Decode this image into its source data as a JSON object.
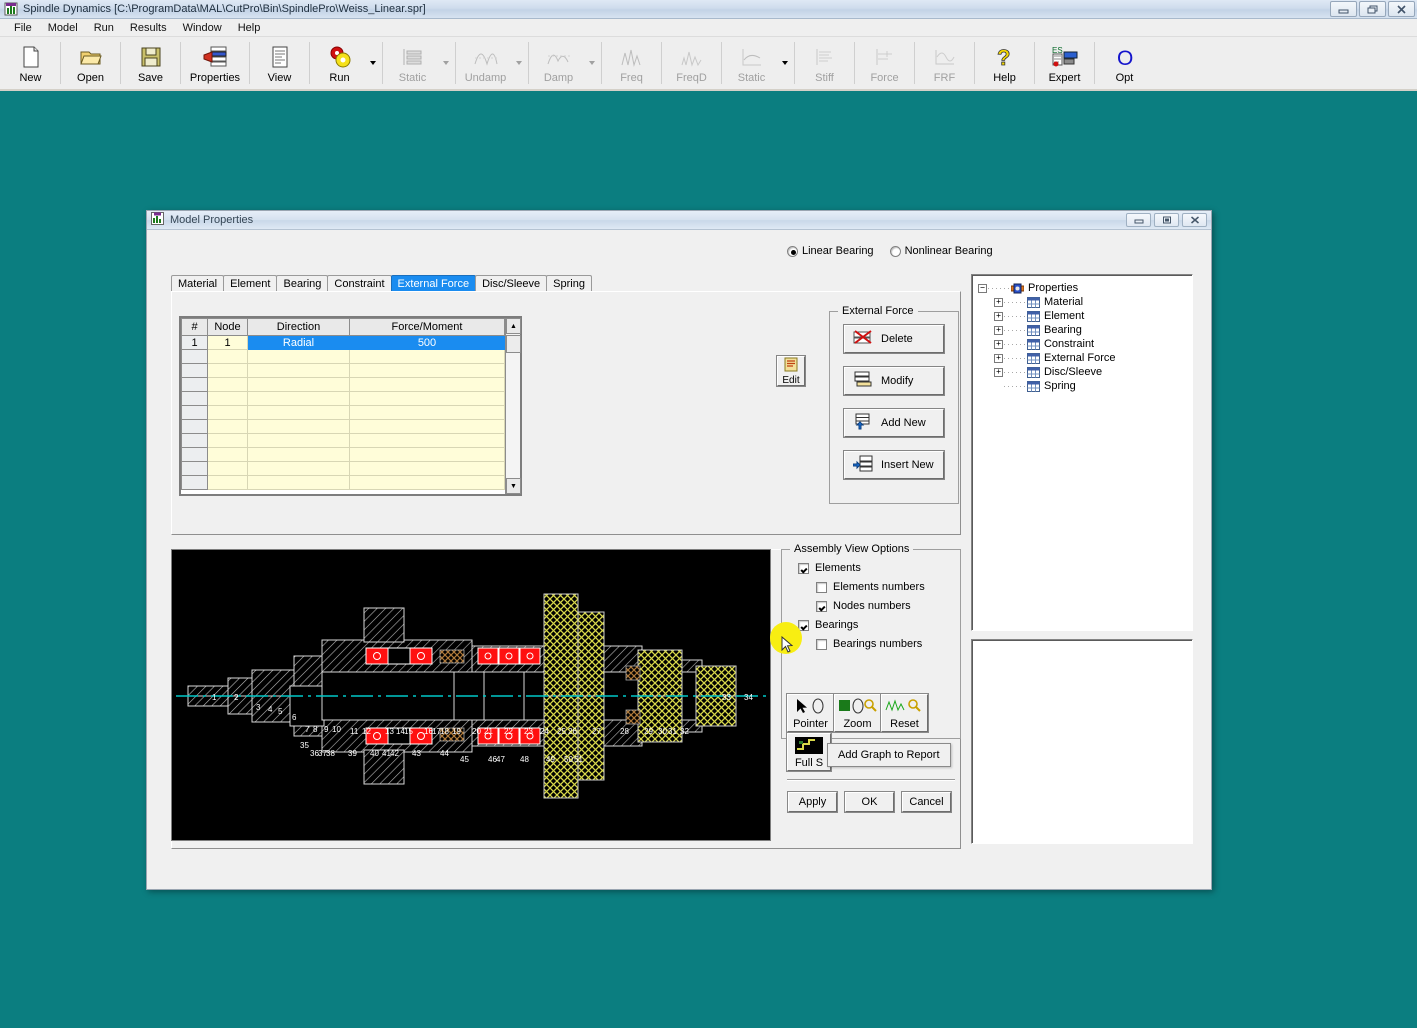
{
  "app": {
    "title": "Spindle Dynamics [C:\\ProgramData\\MAL\\CutPro\\Bin\\SpindlePro\\Weiss_Linear.spr]",
    "icon": "spindle-app-icon",
    "window_buttons": [
      {
        "name": "minimize",
        "glyph": "—"
      },
      {
        "name": "restore",
        "glyph": "❐"
      },
      {
        "name": "close",
        "glyph": "✕"
      }
    ],
    "menu": [
      {
        "label": "File"
      },
      {
        "label": "Model"
      },
      {
        "label": "Run"
      },
      {
        "label": "Results"
      },
      {
        "label": "Window"
      },
      {
        "label": "Help"
      }
    ]
  },
  "toolbar": {
    "buttons": [
      {
        "label": "New",
        "icon": "new-document-icon",
        "enabled": true,
        "dropdown": false
      },
      {
        "label": "Open",
        "icon": "open-folder-icon",
        "enabled": true,
        "dropdown": false
      },
      {
        "label": "Save",
        "icon": "floppy-disk-icon",
        "enabled": true,
        "dropdown": false
      },
      {
        "label": "Properties",
        "icon": "properties-icon",
        "enabled": true,
        "dropdown": false
      },
      {
        "label": "View",
        "icon": "view-page-icon",
        "enabled": true,
        "dropdown": false
      },
      {
        "label": "Run",
        "icon": "run-gears-icon",
        "enabled": true,
        "dropdown": true
      },
      {
        "label": "Static",
        "icon": "static-icon",
        "enabled": false,
        "dropdown": true
      },
      {
        "label": "Undamp",
        "icon": "undamped-icon",
        "enabled": false,
        "dropdown": true
      },
      {
        "label": "Damp",
        "icon": "damped-icon",
        "enabled": false,
        "dropdown": true
      },
      {
        "label": "Freq",
        "icon": "frequency-icon",
        "enabled": false,
        "dropdown": false
      },
      {
        "label": "FreqD",
        "icon": "frequency-d-icon",
        "enabled": false,
        "dropdown": false
      },
      {
        "label": "Static",
        "icon": "static-plot-icon",
        "enabled": false,
        "dropdown": true
      },
      {
        "label": "Stiff",
        "icon": "stiffness-icon",
        "enabled": false,
        "dropdown": false
      },
      {
        "label": "Force",
        "icon": "force-icon",
        "enabled": false,
        "dropdown": false
      },
      {
        "label": "FRF",
        "icon": "frf-icon",
        "enabled": false,
        "dropdown": false
      },
      {
        "label": "Help",
        "icon": "help-question-icon",
        "enabled": true,
        "dropdown": false
      },
      {
        "label": "Expert",
        "icon": "expert-system-icon",
        "enabled": true,
        "dropdown": false
      },
      {
        "label": "Opt",
        "icon": "optimization-icon",
        "enabled": true,
        "dropdown": false
      }
    ]
  },
  "dialog": {
    "title": "Model Properties",
    "icon": "model-properties-icon",
    "window_buttons": [
      {
        "name": "minimize",
        "glyph": "—"
      },
      {
        "name": "maximize",
        "glyph": "▣"
      },
      {
        "name": "close",
        "glyph": "✕"
      }
    ],
    "bearing_mode": {
      "options": [
        {
          "label": "Linear Bearing",
          "selected": true
        },
        {
          "label": "Nonlinear Bearing",
          "selected": false
        }
      ]
    },
    "tabs": [
      {
        "label": "Material",
        "active": false
      },
      {
        "label": "Element",
        "active": false
      },
      {
        "label": "Bearing",
        "active": false
      },
      {
        "label": "Constraint",
        "active": false
      },
      {
        "label": "External Force",
        "active": true
      },
      {
        "label": "Disc/Sleeve",
        "active": false
      },
      {
        "label": "Spring",
        "active": false
      }
    ],
    "grid": {
      "columns": [
        "#",
        "Node",
        "Direction",
        "Force/Moment"
      ],
      "rows": [
        {
          "index": "1",
          "node": "1",
          "direction": "Radial",
          "force": "500",
          "selected": true
        },
        {
          "index": "",
          "node": "",
          "direction": "",
          "force": "",
          "selected": false
        },
        {
          "index": "",
          "node": "",
          "direction": "",
          "force": "",
          "selected": false
        },
        {
          "index": "",
          "node": "",
          "direction": "",
          "force": "",
          "selected": false
        },
        {
          "index": "",
          "node": "",
          "direction": "",
          "force": "",
          "selected": false
        },
        {
          "index": "",
          "node": "",
          "direction": "",
          "force": "",
          "selected": false
        },
        {
          "index": "",
          "node": "",
          "direction": "",
          "force": "",
          "selected": false
        },
        {
          "index": "",
          "node": "",
          "direction": "",
          "force": "",
          "selected": false
        },
        {
          "index": "",
          "node": "",
          "direction": "",
          "force": "",
          "selected": false
        },
        {
          "index": "",
          "node": "",
          "direction": "",
          "force": "",
          "selected": false
        },
        {
          "index": "",
          "node": "",
          "direction": "",
          "force": "",
          "selected": false
        }
      ],
      "scroll_up": "▲",
      "scroll_down": "▼"
    },
    "external_force_group": {
      "title": "External Force",
      "buttons": [
        {
          "label": "Delete",
          "icon": "delete-row-icon"
        },
        {
          "label": "Modify",
          "icon": "modify-row-icon"
        },
        {
          "label": "Add New",
          "icon": "add-row-icon"
        },
        {
          "label": "Insert New",
          "icon": "insert-row-icon"
        }
      ]
    },
    "edit_button": {
      "label": "Edit",
      "icon": "edit-notepad-icon"
    },
    "assembly_view_options": {
      "title": "Assembly View Options",
      "checkboxes": [
        {
          "label": "Elements",
          "checked": true,
          "indent": 0
        },
        {
          "label": "Elements numbers",
          "checked": false,
          "indent": 1
        },
        {
          "label": "Nodes numbers",
          "checked": true,
          "indent": 1
        },
        {
          "label": "Bearings",
          "checked": true,
          "indent": 0
        },
        {
          "label": "Bearings numbers",
          "checked": false,
          "indent": 1
        }
      ]
    },
    "view_tools": [
      {
        "label": "Pointer",
        "icon": "pointer-tool-icon"
      },
      {
        "label": "Zoom",
        "icon": "zoom-tool-icon"
      },
      {
        "label": "Reset",
        "icon": "reset-tool-icon"
      }
    ],
    "fullscreen_button": {
      "label": "Full S",
      "icon": "full-screen-graph-icon"
    },
    "tooltip": {
      "text": "Add Graph to Report"
    },
    "action_buttons": [
      {
        "label": "Apply"
      },
      {
        "label": "OK"
      },
      {
        "label": "Cancel"
      }
    ]
  },
  "tree": {
    "root": {
      "label": "Properties",
      "icon": "properties-root-icon",
      "expander": "−"
    },
    "items": [
      {
        "label": "Material",
        "icon": "table-icon",
        "expander": "+"
      },
      {
        "label": "Element",
        "icon": "table-icon",
        "expander": "+"
      },
      {
        "label": "Bearing",
        "icon": "table-icon",
        "expander": "+"
      },
      {
        "label": "Constraint",
        "icon": "table-icon",
        "expander": "+"
      },
      {
        "label": "External Force",
        "icon": "table-icon",
        "expander": "+"
      },
      {
        "label": "Disc/Sleeve",
        "icon": "table-icon",
        "expander": "+"
      },
      {
        "label": "Spring",
        "icon": "table-icon",
        "expander": ""
      }
    ]
  },
  "assembly": {
    "title": "spindle-assembly-cross-section",
    "background": "#000000",
    "axis_color": "#00c0c0",
    "node_labels": [
      "1",
      "2",
      "3",
      "4",
      "5",
      "6",
      "7",
      "8",
      "9",
      "10",
      "11",
      "12",
      "13",
      "14",
      "15",
      "16",
      "17",
      "18",
      "19",
      "20",
      "21",
      "22",
      "23",
      "24",
      "25",
      "26",
      "27",
      "28",
      "29",
      "30",
      "31",
      "32",
      "33",
      "34",
      "35",
      "36",
      "37",
      "38",
      "39",
      "40",
      "41",
      "42",
      "43",
      "44",
      "45",
      "46",
      "47",
      "48",
      "49",
      "50",
      "51"
    ],
    "bearing_color": "#ff0000",
    "disc_color": "#d8d84a",
    "element_color": "#dcdcdc"
  },
  "colors": {
    "desktop": "#0b7e80",
    "dialog_face": "#f0f0f0",
    "accent_selection": "#1a8cf0",
    "grid_cell": "#fffdd9",
    "cursor_highlight": "#f8ee12"
  }
}
